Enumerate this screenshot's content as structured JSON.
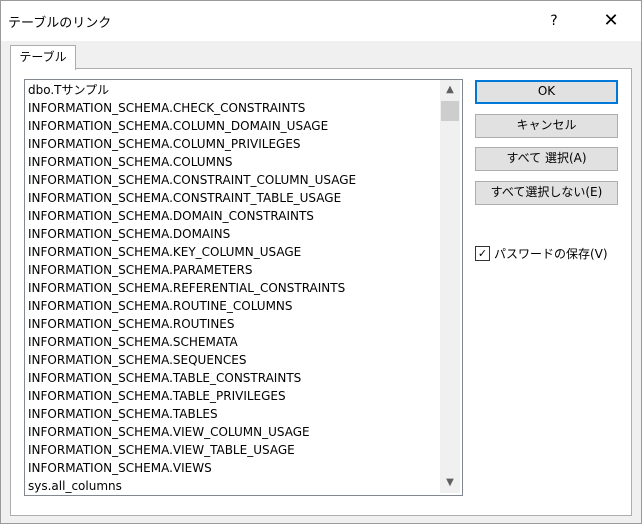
{
  "window": {
    "title": "テーブルのリンク",
    "help_label": "?",
    "close_label": "✕"
  },
  "tabs": [
    {
      "label": "テーブル",
      "selected": true
    }
  ],
  "table_list": {
    "items": [
      "dbo.Tサンプル",
      "INFORMATION_SCHEMA.CHECK_CONSTRAINTS",
      "INFORMATION_SCHEMA.COLUMN_DOMAIN_USAGE",
      "INFORMATION_SCHEMA.COLUMN_PRIVILEGES",
      "INFORMATION_SCHEMA.COLUMNS",
      "INFORMATION_SCHEMA.CONSTRAINT_COLUMN_USAGE",
      "INFORMATION_SCHEMA.CONSTRAINT_TABLE_USAGE",
      "INFORMATION_SCHEMA.DOMAIN_CONSTRAINTS",
      "INFORMATION_SCHEMA.DOMAINS",
      "INFORMATION_SCHEMA.KEY_COLUMN_USAGE",
      "INFORMATION_SCHEMA.PARAMETERS",
      "INFORMATION_SCHEMA.REFERENTIAL_CONSTRAINTS",
      "INFORMATION_SCHEMA.ROUTINE_COLUMNS",
      "INFORMATION_SCHEMA.ROUTINES",
      "INFORMATION_SCHEMA.SCHEMATA",
      "INFORMATION_SCHEMA.SEQUENCES",
      "INFORMATION_SCHEMA.TABLE_CONSTRAINTS",
      "INFORMATION_SCHEMA.TABLE_PRIVILEGES",
      "INFORMATION_SCHEMA.TABLES",
      "INFORMATION_SCHEMA.VIEW_COLUMN_USAGE",
      "INFORMATION_SCHEMA.VIEW_TABLE_USAGE",
      "INFORMATION_SCHEMA.VIEWS",
      "sys.all_columns"
    ]
  },
  "buttons": {
    "ok": "OK",
    "cancel": "キャンセル",
    "select_all": "すべて 選択(A)",
    "deselect_all": "すべて選択しない(E)"
  },
  "save_password": {
    "label": "パスワードの保存(V)",
    "checked": true,
    "check_glyph": "✓"
  }
}
